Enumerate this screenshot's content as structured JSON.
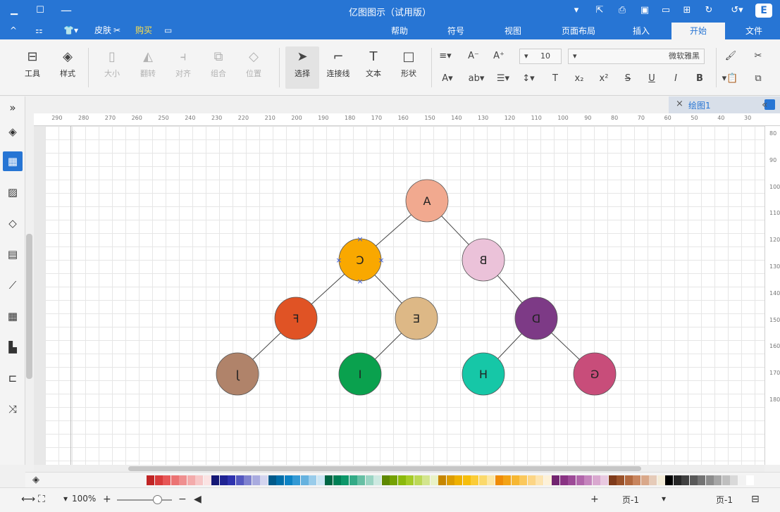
{
  "app": {
    "title": "亿图图示（试用版）"
  },
  "titlebar": {
    "icons": [
      "app-logo",
      "more-icon",
      "undo-icon",
      "redo-icon",
      "new-icon",
      "open-icon",
      "save-icon",
      "print-icon",
      "export-icon",
      "dropdown-icon",
      "minimize-icon",
      "maximize-icon",
      "close-icon"
    ]
  },
  "quick_access": {
    "buy": "购买",
    "skin": "皮肤",
    "chevron": "^"
  },
  "menu_tabs": [
    {
      "label": "文件"
    },
    {
      "label": "开始"
    },
    {
      "label": "插入"
    },
    {
      "label": "页面布局"
    },
    {
      "label": "视图"
    },
    {
      "label": "符号"
    },
    {
      "label": "帮助"
    }
  ],
  "ribbon": {
    "font_name": "微软雅黑",
    "font_size": "10",
    "buttons": {
      "shape": "形状",
      "text": "文本",
      "connector": "连接线",
      "select": "选择",
      "position": "位置",
      "group": "组合",
      "align": "对齐",
      "rotate": "翻转",
      "size": "大小",
      "style": "样式",
      "tools": "工具"
    },
    "font_controls": [
      "B",
      "I",
      "U",
      "S",
      "x²",
      "x₂",
      "T",
      "ab",
      "A",
      "A⁺",
      "A⁻"
    ]
  },
  "document": {
    "tab_name": "绘图1",
    "close": "×"
  },
  "rulers": {
    "horizontal": [
      "30",
      "40",
      "50",
      "60",
      "70",
      "80",
      "90",
      "100",
      "110",
      "120",
      "130",
      "140",
      "150",
      "160",
      "170",
      "180",
      "190",
      "200",
      "210",
      "220",
      "230",
      "240",
      "250",
      "260",
      "270",
      "280",
      "290"
    ],
    "vertical": [
      "80",
      "90",
      "100",
      "110",
      "120",
      "130",
      "140",
      "150",
      "160",
      "170",
      "180"
    ]
  },
  "tree": {
    "nodes": [
      {
        "id": "A",
        "label": "A",
        "color": "#f1a98f"
      },
      {
        "id": "B",
        "label": "B",
        "color": "#ebc2d9"
      },
      {
        "id": "C",
        "label": "C",
        "color": "#f9a800",
        "selected": true
      },
      {
        "id": "D",
        "label": "D",
        "color": "#7d3a86"
      },
      {
        "id": "E",
        "label": "E",
        "color": "#ddb886"
      },
      {
        "id": "F",
        "label": "F",
        "color": "#e05325"
      },
      {
        "id": "G",
        "label": "G",
        "color": "#c84d7a"
      },
      {
        "id": "H",
        "label": "H",
        "color": "#16c7a7"
      },
      {
        "id": "I",
        "label": "I",
        "color": "#0aa14e"
      },
      {
        "id": "J",
        "label": "J",
        "color": "#b0836a"
      }
    ],
    "edges": [
      [
        "A",
        "C"
      ],
      [
        "A",
        "B"
      ],
      [
        "C",
        "F"
      ],
      [
        "C",
        "E"
      ],
      [
        "B",
        "D"
      ],
      [
        "F",
        "J"
      ],
      [
        "E",
        "I"
      ],
      [
        "D",
        "H"
      ],
      [
        "D",
        "G"
      ]
    ]
  },
  "palette": [
    "#ffffff",
    "#f2f2f2",
    "#d9d9d9",
    "#bfbfbf",
    "#a6a6a6",
    "#8c8c8c",
    "#737373",
    "#595959",
    "#404040",
    "#262626",
    "#000000",
    "#f4ecd8",
    "#e6cbb8",
    "#d9a88a",
    "#c8855e",
    "#b2693f",
    "#9a522a",
    "#7f3b1b",
    "#e9c9e0",
    "#d9a8cf",
    "#c585bd",
    "#b166aa",
    "#9d4a97",
    "#893383",
    "#722570",
    "#fdf1d8",
    "#fde4b0",
    "#fcd585",
    "#fbc85c",
    "#f6b733",
    "#f3a316",
    "#ef8c07",
    "#fce7a6",
    "#fbd96c",
    "#fbcc37",
    "#f6be0c",
    "#eeb000",
    "#dc9c00",
    "#c68600",
    "#e9f2c7",
    "#d3e58e",
    "#bcd856",
    "#a5cb27",
    "#8bb90c",
    "#74a102",
    "#5e8800",
    "#cde9e1",
    "#9ad4c3",
    "#66bfa4",
    "#33aa86",
    "#0c9769",
    "#007f55",
    "#006644",
    "#cce6f4",
    "#99ccea",
    "#66b2df",
    "#3399d4",
    "#0c82c4",
    "#006ea9",
    "#005a8a",
    "#d4d5ef",
    "#a9abdf",
    "#7f82cf",
    "#5458bf",
    "#2e32ae",
    "#1f2393",
    "#151875",
    "#fbe3e3",
    "#f7c7c7",
    "#f3abab",
    "#ef8f8f",
    "#eb7373",
    "#e75757",
    "#d83b3b",
    "#c02525"
  ],
  "statusbar": {
    "page_dropdown": "页-1",
    "page_current": "页-1",
    "add_page": "+",
    "zoom": "100%",
    "zoom_out": "−",
    "zoom_in": "+"
  }
}
